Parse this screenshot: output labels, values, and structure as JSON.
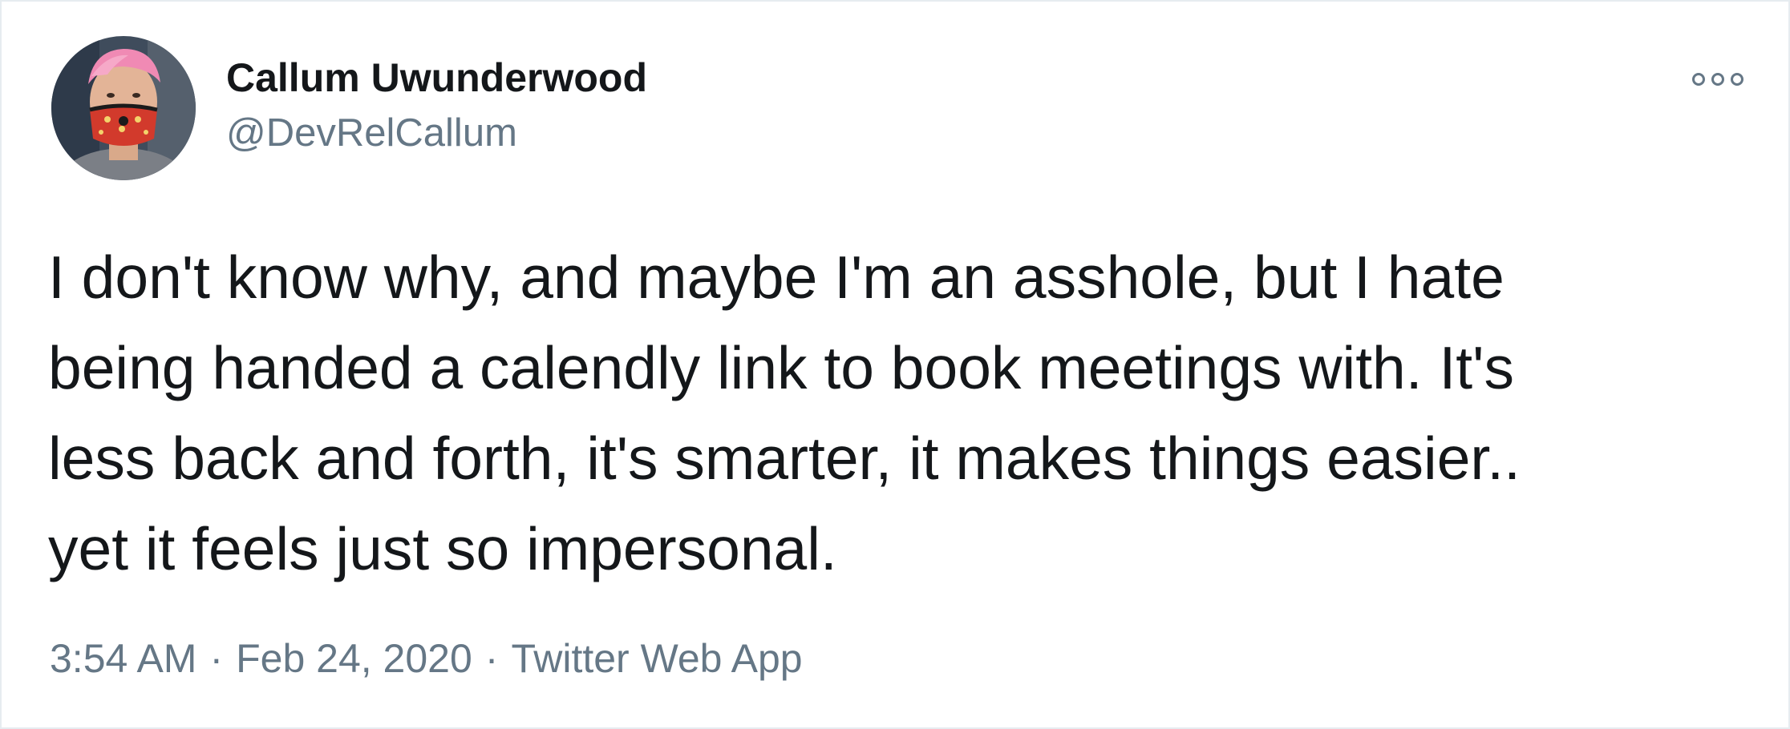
{
  "user": {
    "display_name": "Callum Uwunderwood",
    "handle": "@DevRelCallum",
    "avatar_icon": "profile-photo-masked-person"
  },
  "more_menu": {
    "icon": "more-options-icon"
  },
  "tweet": {
    "lines": [
      "I don't know why, and maybe I'm an asshole, but I hate",
      "being handed a calendly link to book meetings with. It's",
      "less back and forth, it's smarter, it makes things easier..",
      "yet it feels just so impersonal."
    ],
    "time": "3:54 AM",
    "separator": "·",
    "date": "Feb 24, 2020",
    "source": "Twitter Web App"
  },
  "colors": {
    "text_primary": "#14171a",
    "text_secondary": "#657786",
    "border": "#e6ecf0"
  }
}
